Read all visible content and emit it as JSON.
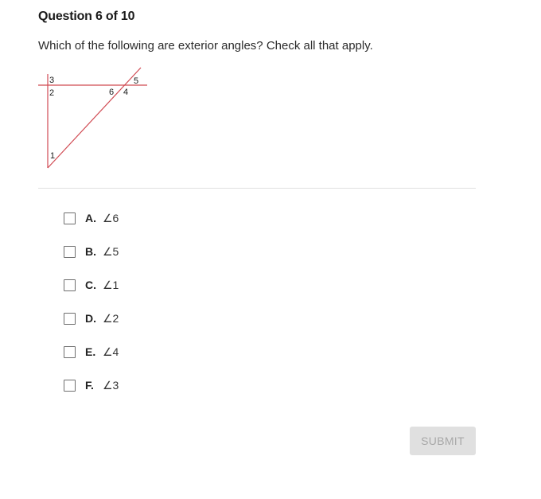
{
  "question": {
    "title": "Question 6 of 10",
    "text": "Which of the following are exterior angles? Check all that apply."
  },
  "figure": {
    "line_color": "#d04a52",
    "labels": [
      "3",
      "2",
      "6",
      "4",
      "5",
      "1"
    ]
  },
  "options": [
    {
      "letter": "A.",
      "value": "∠6",
      "checked": false
    },
    {
      "letter": "B.",
      "value": "∠5",
      "checked": false
    },
    {
      "letter": "C.",
      "value": "∠1",
      "checked": false
    },
    {
      "letter": "D.",
      "value": "∠2",
      "checked": false
    },
    {
      "letter": "E.",
      "value": "∠4",
      "checked": false
    },
    {
      "letter": "F.",
      "value": "∠3",
      "checked": false
    }
  ],
  "submit": {
    "label": "SUBMIT",
    "enabled": false
  }
}
